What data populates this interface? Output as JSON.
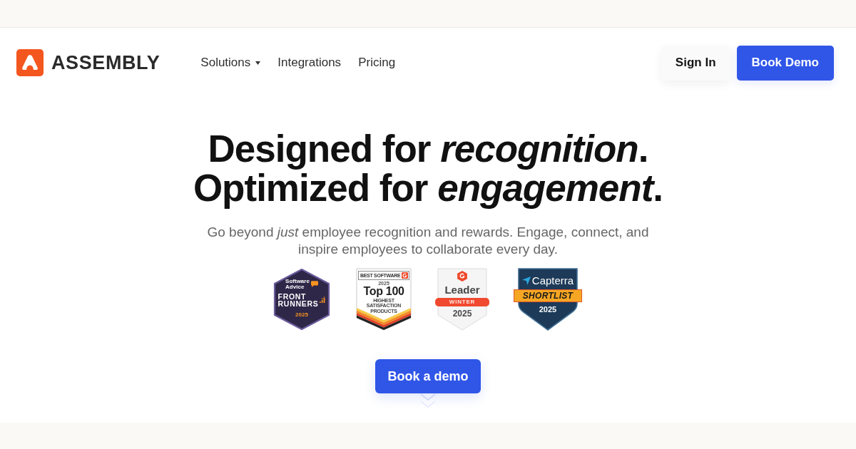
{
  "header": {
    "logo": {
      "wordmark": "ASSEMBLY"
    },
    "nav": [
      {
        "label": "Solutions",
        "kind": "dropdown"
      },
      {
        "label": "Integrations",
        "kind": "link"
      },
      {
        "label": "Pricing",
        "kind": "link"
      }
    ],
    "actions": [
      {
        "label": "Sign In",
        "kind": "secondary"
      },
      {
        "label": "Book Demo",
        "kind": "primary"
      }
    ]
  },
  "hero": {
    "headline": [
      "Designed for *recognition*.",
      "Optimized for *engagement*."
    ],
    "subtitle": "Go beyond *just* employee recognition and rewards. Engage, connect, and inspire employees to collaborate every day.",
    "awards": [
      {
        "kind": "software-advice",
        "brand": "Software Advice",
        "title": "FRONT RUNNERS",
        "year": "2025"
      },
      {
        "kind": "g2-top",
        "header": "BEST SOFTWARE",
        "year": "2025",
        "title": "Top 100",
        "caption": "HIGHEST SATISFACTION PRODUCTS"
      },
      {
        "kind": "g2-leader",
        "title": "Leader",
        "ribbon": "WINTER",
        "year": "2025"
      },
      {
        "kind": "capterra",
        "brand": "Capterra",
        "ribbon": "SHORTLIST",
        "year": "2025"
      }
    ],
    "cta": {
      "label": "Book a demo"
    }
  }
}
